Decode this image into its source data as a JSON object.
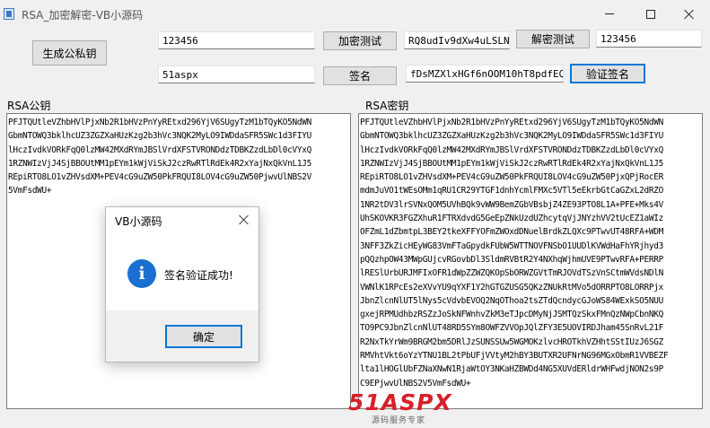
{
  "window": {
    "title": "RSA_加密解密-VB小源码",
    "minimize_icon": "minimize-icon",
    "maximize_icon": "maximize-icon",
    "close_icon": "close-icon"
  },
  "buttons": {
    "generate_keys": "生成公私钥",
    "encrypt_test": "加密测试",
    "decrypt_test": "解密测试",
    "sign": "签名",
    "verify_sign": "验证签名"
  },
  "fields": {
    "plaintext": "123456",
    "ciphertext": "RQ8udIv9dXw4uLSLNV&",
    "decrypted": "123456",
    "sign_input": "51aspx",
    "signature": "fDsMZXlxHGf6nOOM10hT8pdfEQ5el"
  },
  "labels": {
    "public_key": "RSA公钥",
    "private_key": "RSA密钥"
  },
  "public_key_lines": [
    "PFJTQUtleVZhbHVlPjxNb2R1bHVzPnYyREtxd296YjV6SUgyTzM1bTQyKO5NdWN",
    "GbmNTOWQ3bklhcUZ3ZGZXaHUzKzg2b3hVc3NQK2MyLO9IWDdaSFR5SWc1d3FIYU",
    "lHczIvdkVORkFqQ0lzMW42MXdRYmJBSlVrdXFSTVRONDdzTDBKZzdLbDl0cVYxQ",
    "1RZNWIzVjJ4SjBBOUtMM1pEYm1kWjViSkJ2czRwRTlRdEk4R2xYajNxQkVnL1J5",
    "REpiRTO8LO1vZHVsdXM+PEV4cG9uZW50PkFRQUI8LOV4cG9uZW50PjwvUlNBS2V",
    "5VmFsdWU+"
  ],
  "private_key_lines": [
    "PFJTQUtleVZhbHVlPjxNb2R1bHVzPnYyREtxd296YjV6SUgyTzM1bTQyKO5NdWN",
    "GbmNTOWQ3bklhcUZ3ZGZXaHUzKzg2b3hVc3NQK2MyLO9IWDdaSFR5SWc1d3FIYU",
    "lHczIvdkVORkFqQ0lzMW42MXdRYmJBSlVrdXFSTVRONDdzTDBKZzdLbDl0cVYxQ",
    "1RZNWIzVjJ4SjBBOUtMM1pEYm1kWjViSkJ2czRwRTlRdEk4R2xYajNxQkVnL1J5",
    "REpiRTO8LO1vZHVsdXM+PEV4cG9uZW50PkFRQUI8LOV4cG9uZW50PjxQPjRocER",
    "mdmJuVO1tWEsOMm1qRU1CR29YTGF1dnhYcmlFMXc5VTl5eEkrbGtCaGZxL2dRZO",
    "1NR2tDV3lrSVNxQOM5UVhBQk9vWW9BemZGbVBsbjZ4ZE93PTO8L1A+PFE+Mks4V",
    "UhSKOVKR3FGZXhuR1FTRXdvdG5GeEpZNkUzdUZhcytqVjJNYzhVV2tUcEZ1aWIz",
    "OFZmL1dZbmtpL3BEY2tkeXFFYOFmZWOxdDNuelBrdkZLQXc9PTwvUT48RFA+WDM",
    "3NFF3ZkZicHEyWG83VmFTaGpydkFUbW5WTTNOVFNSbO1UUDlKVWdHaFhYRjhyd3",
    "pQQzhpOW43MWpGUjcvRGovbDl3SldmRVBtR2Y4NXhqWjhmUVE9PTwvRFA+PERRP",
    "lRESlUrbURJMFIxOFR1dWpZZWZQKOpSbORWZGVtTmRJOVdTSzVnSCtmWVdsNDlN",
    "VWNlK1RPcEs2eXVvYU9qYXF1Y2hGTGZUSG5QKzZNUkRtMVo5dORRPTO8LORRPjx",
    "JbnZlcnNlUT5lNys5cVdvbEVOQ2NqOThoa2tsZTdQcndycGJoWS84WExkSO5NUU",
    "gxejRPMUdhbzRSZzJoSkNFWnhvZkM3eTJpcDMyNjJSMTQzSkxFMnQzNWpCbnNKQ",
    "TO9PC9JbnZlcnNlUT48RD5SYm8OWFZVVOpJQlZFY3E5UOVIRDJham45SnRvL21F",
    "R2NxTkYrWm9BRGM2bm5DRlJzSUNSSUw5WGMOKzlvcHROTkhVZHhtSStIUzJ6SGZ",
    "RMVhtVkt6oYzYTNU1BL2tPbUFjVVtyM2hBY3BUTXR2UFNrNG96MGxObmR1VVBEZF",
    "lta1lHOGlUbFZNaXNwN1RjaWtOY3NKaHZBWDd4NG5XUVdERldrWHFwdjNON2s9P",
    "C9EPjwvUlNBS2V5VmFsdWU+"
  ],
  "dialog": {
    "title": "VB小源码",
    "message": "签名验证成功!",
    "ok": "确定",
    "icon": "info-icon",
    "close_icon": "close-icon"
  },
  "watermark": {
    "logo": "51ASPX",
    "subtitle": "源码服务专家"
  },
  "colors": {
    "accent": "#0078d7",
    "info_icon": "#1a6fd0",
    "watermark": "#d8202a"
  }
}
